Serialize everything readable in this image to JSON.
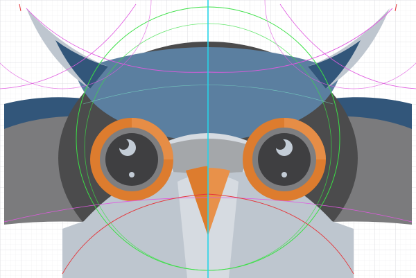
{
  "canvas": {
    "grid": true,
    "colors": {
      "background": "#ffffff",
      "grid_minor": "#ececef",
      "grid_major": "#d6d6db",
      "guide_green": "#3be046",
      "guide_magenta": "#e05ae0",
      "guide_red": "#e5383c",
      "guide_cyan": "#25d4e8"
    }
  },
  "artwork": {
    "subject": "owl-face",
    "colors": {
      "head_dark": "#4b4b4c",
      "body_gray": "#7b7b7d",
      "navy": "#32567a",
      "crown_blue": "#5b7fa0",
      "pale": "#bec6cf",
      "face_light": "#d6dbe1",
      "orange": "#dd7c2e",
      "orange_light": "#e8914a",
      "iris_gray": "#7e7e80",
      "pupil": "#3f3f41",
      "highlight": "#c3ccd6"
    }
  }
}
